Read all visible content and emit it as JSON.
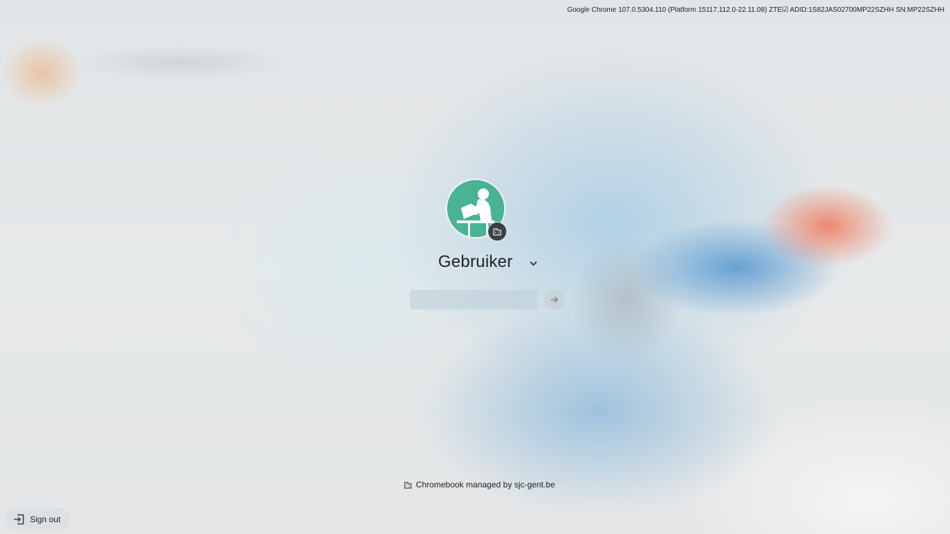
{
  "system": {
    "version_info": "Google Chrome 107.0.5304.110 (Platform 15117.112.0-22.11.08) ZTE☑ ADID:1S82JAS02700MP22SZHH SN:MP22SZHH"
  },
  "user_pod": {
    "name": "Gebruiker",
    "avatar_icon": "person-reading-icon",
    "badge_icon": "enterprise-building-icon",
    "password": {
      "value": "",
      "placeholder": ""
    },
    "submit_icon": "arrow-right-icon"
  },
  "footer": {
    "managed_label": "Chromebook managed by sjc-gent.be",
    "managed_icon": "enterprise-building-icon"
  },
  "shelf": {
    "sign_out_label": "Sign out",
    "sign_out_icon": "sign-out-icon"
  },
  "colors": {
    "avatar_bg": "#48b494",
    "badge_bg": "#3c4043",
    "text": "#202124"
  }
}
